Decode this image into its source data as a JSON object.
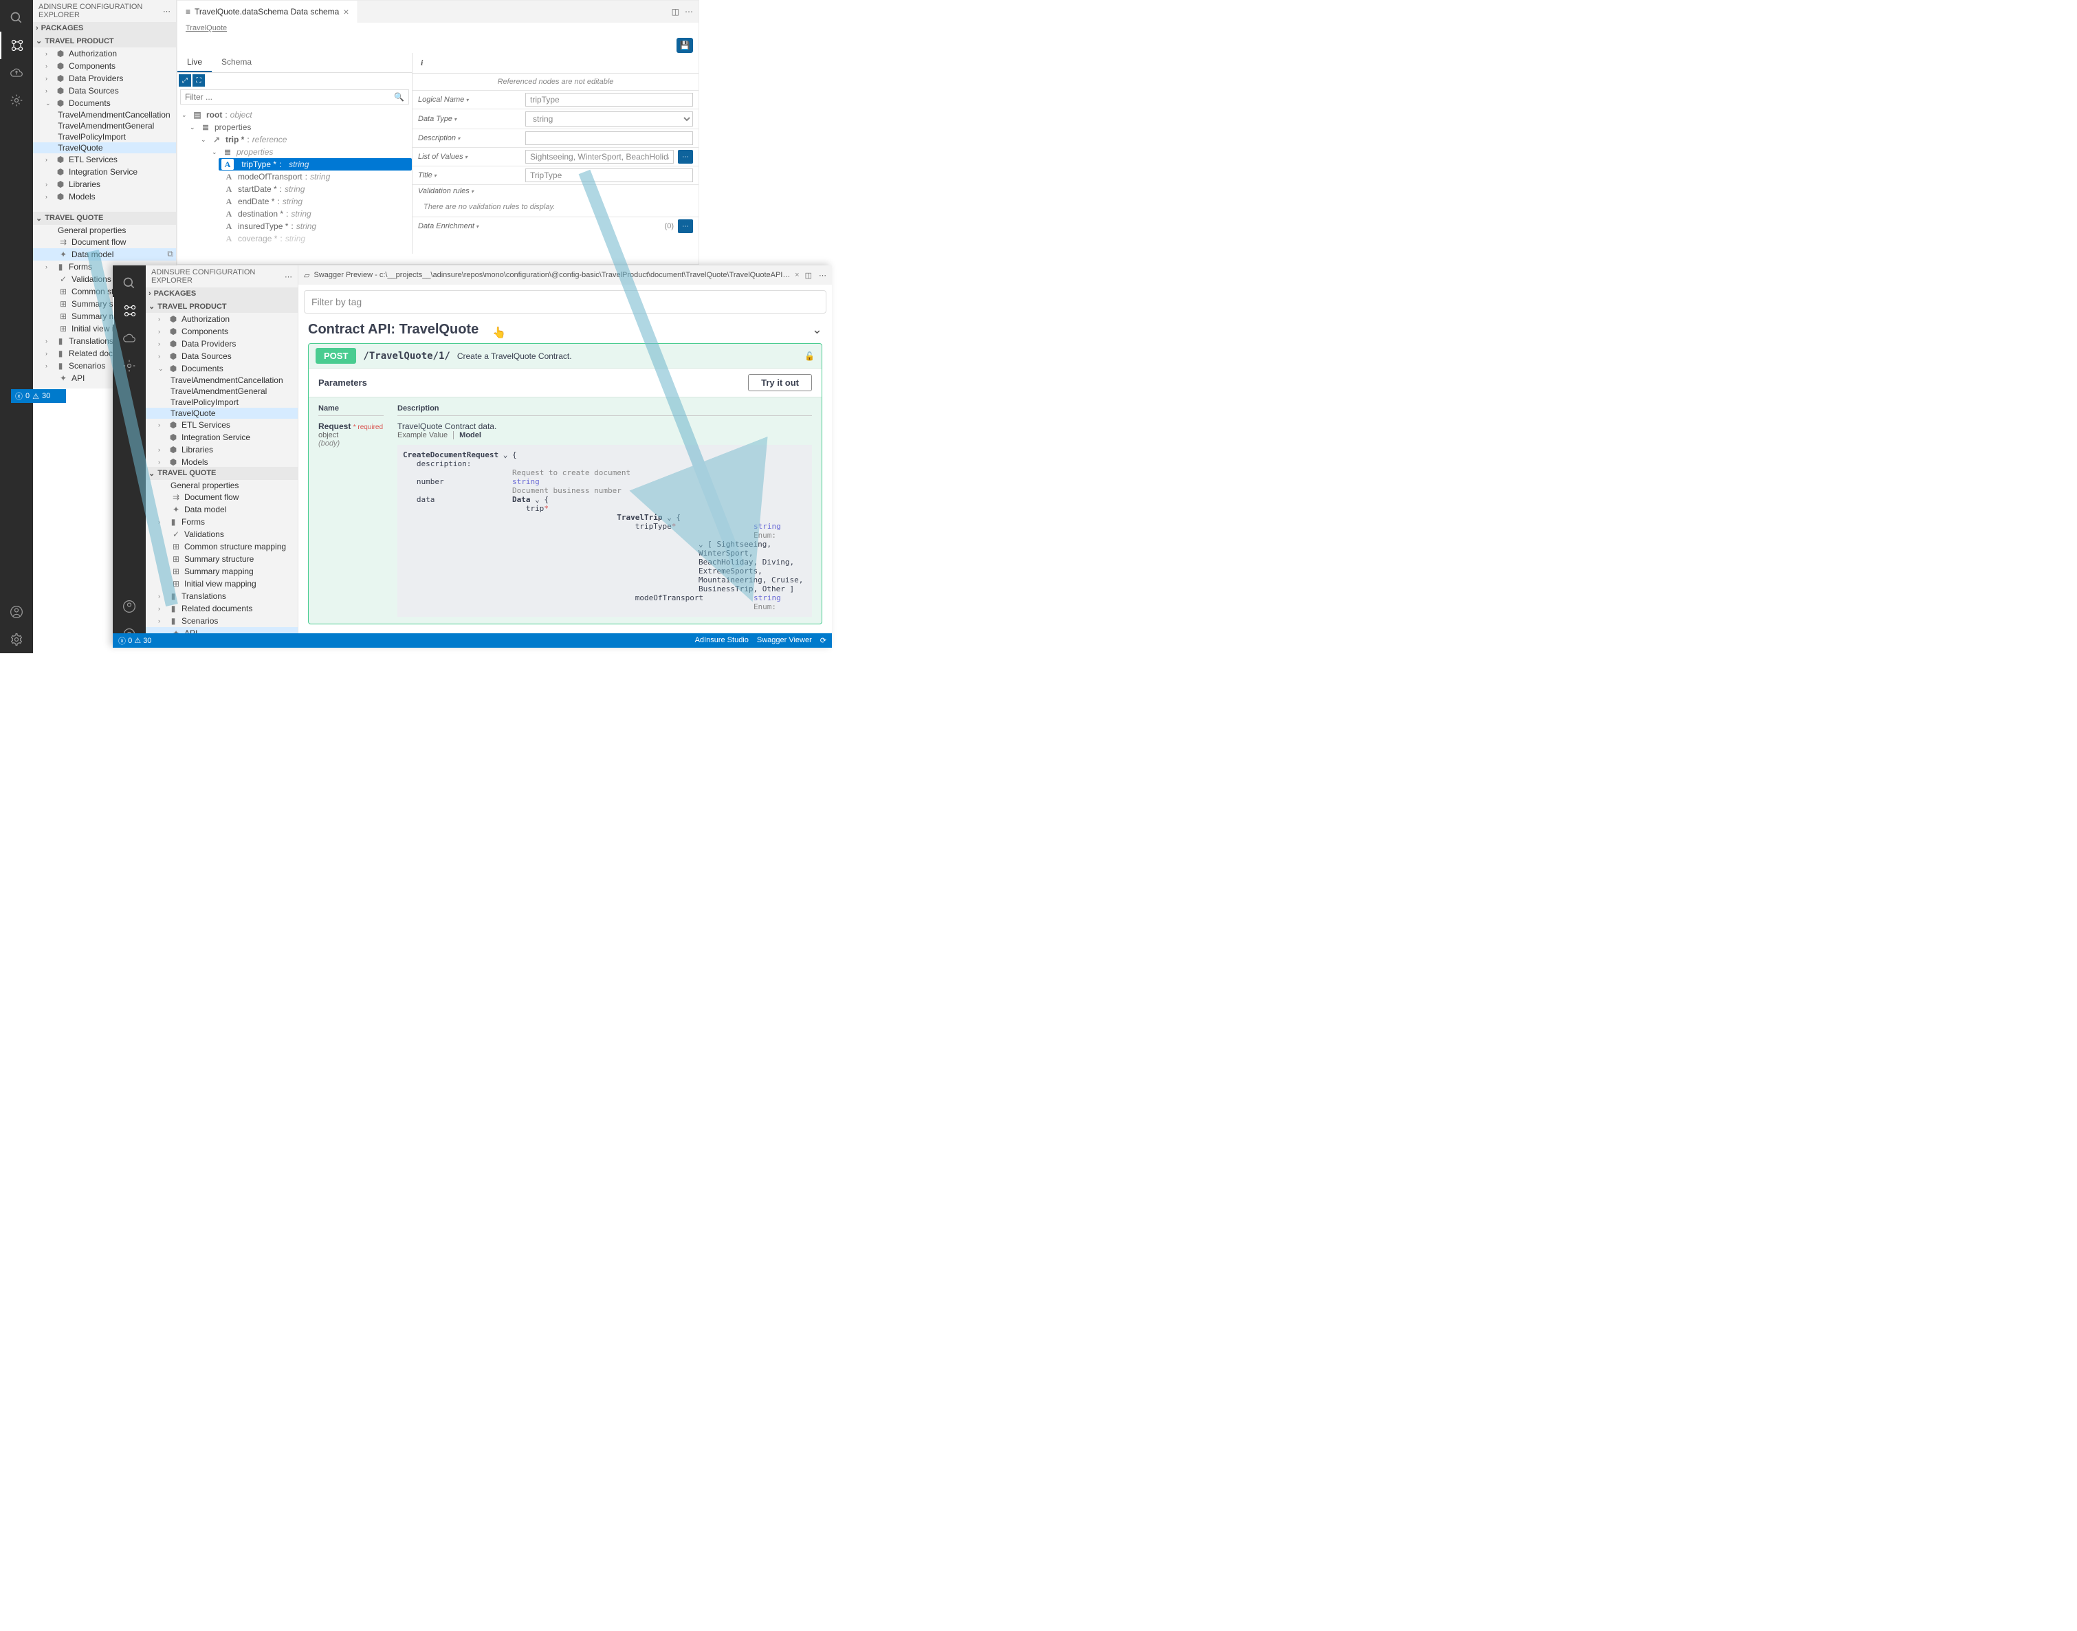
{
  "win1": {
    "sidepanel_title": "ADINSURE CONFIGURATION EXPLORER",
    "sections": {
      "packages": "PACKAGES",
      "travelProduct": "TRAVEL PRODUCT",
      "travelQuote": "TRAVEL QUOTE"
    },
    "travelProduct_items": [
      "Authorization",
      "Components",
      "Data Providers",
      "Data Sources",
      "Documents"
    ],
    "documents_children": [
      "TravelAmendmentCancellation",
      "TravelAmendmentGeneral",
      "TravelPolicyImport",
      "TravelQuote"
    ],
    "after_documents": [
      "ETL Services",
      "Integration Service",
      "Libraries",
      "Models"
    ],
    "travelQuote_items": [
      "General properties",
      "Document flow",
      "Data model",
      "Forms",
      "Validations",
      "Common structure mapping",
      "Summary structure",
      "Summary mapping",
      "Initial view mapping",
      "Translations",
      "Related documents",
      "Scenarios",
      "API"
    ],
    "selected_tq": "TravelQuote",
    "selected_model": "Data model",
    "tab_title": "TravelQuote.dataSchema Data schema",
    "breadcrumb": "TravelQuote",
    "schema_tabs": {
      "live": "Live",
      "schema": "Schema"
    },
    "filter_ph": "Filter ...",
    "root": "root",
    "root_type": "object",
    "properties": "properties",
    "trip": "trip *",
    "trip_type": "reference",
    "props": [
      {
        "name": "tripType *",
        "type": "string",
        "sel": true
      },
      {
        "name": "modeOfTransport",
        "type": "string"
      },
      {
        "name": "startDate *",
        "type": "string"
      },
      {
        "name": "endDate *",
        "type": "string"
      },
      {
        "name": "destination *",
        "type": "string"
      },
      {
        "name": "insuredType *",
        "type": "string"
      },
      {
        "name": "coverage *",
        "type": "string"
      }
    ],
    "notice": "Referenced nodes are not editable",
    "form": {
      "logicalName": {
        "label": "Logical Name",
        "value": "tripType"
      },
      "dataType": {
        "label": "Data Type",
        "value": "string"
      },
      "description": {
        "label": "Description",
        "value": ""
      },
      "listOfValues": {
        "label": "List of Values",
        "value": "Sightseeing, WinterSport, BeachHoliday,"
      },
      "title": {
        "label": "Title",
        "value": "TripType"
      },
      "validation": {
        "label": "Validation rules",
        "none": "There are no validation rules to display."
      },
      "enrichment": {
        "label": "Data Enrichment",
        "count": "(0)"
      }
    }
  },
  "win2": {
    "sidepanel_title": "ADINSURE CONFIGURATION EXPLORER",
    "selected_api": "API",
    "tab_title": "Swagger Preview - c:\\__projects__\\adinsure\\repos\\mono\\configuration\\@config-basic\\TravelProduct\\document\\TravelQuote\\TravelQuoteAPI.json",
    "filter_ph": "Filter by tag",
    "api_title": "Contract API: TravelQuote",
    "method": "POST",
    "path": "/TravelQuote/1/",
    "summary": "Create a TravelQuote Contract.",
    "parameters": "Parameters",
    "tryit": "Try it out",
    "col_name": "Name",
    "col_desc": "Description",
    "param_name": "Request",
    "required": "* required",
    "param_type": "object",
    "param_loc": "(body)",
    "param_desc": "TravelQuote Contract data.",
    "example_value": "Example Value",
    "model": "Model",
    "statusbar": {
      "errors": "0",
      "warnings": "30",
      "right1": "AdInsure Studio",
      "right2": "Swagger Viewer"
    },
    "model_tree": {
      "root": "CreateDocumentRequest",
      "root_desc": "description:",
      "root_desc_val": "Request to create document",
      "number": "number",
      "number_type": "string",
      "number_desc": "Document business number",
      "data": "data",
      "data_obj": "Data",
      "trip": "trip*",
      "traveltrip": "TravelTrip",
      "tripType": "tripType*",
      "tripType_type": "string",
      "enum_label": "Enum:",
      "enum_val": "[ Sightseeing, WinterSport, BeachHoliday, Diving, ExtremeSports, Mountaineering, Cruise, BusinessTrip, Other ]",
      "modeOfTransport": "modeOfTransport",
      "mot_type": "string",
      "mot_enum": "Enum:"
    }
  },
  "status1": {
    "errors": "0",
    "warnings": "30"
  }
}
